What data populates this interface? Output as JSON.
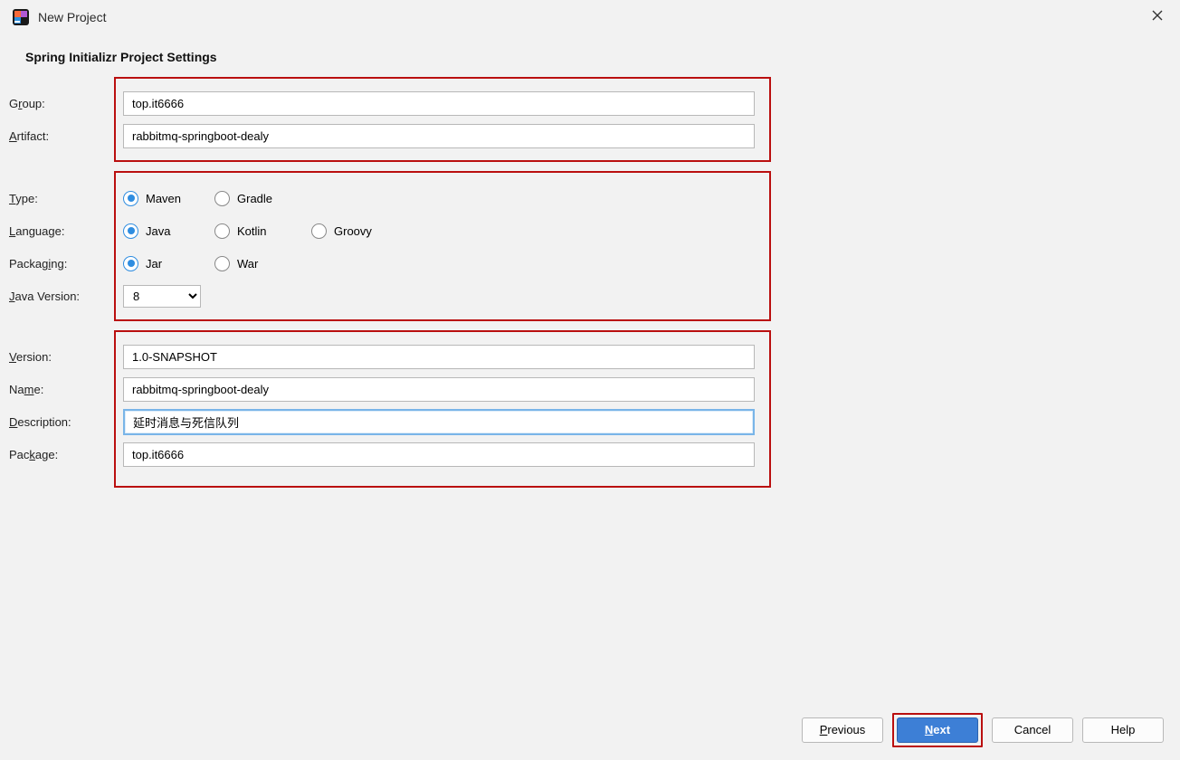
{
  "window": {
    "title": "New Project"
  },
  "heading": "Spring Initializr Project Settings",
  "labels": {
    "group_pre": "G",
    "group_u": "r",
    "group_post": "oup:",
    "artifact_u": "A",
    "artifact_post": "rtifact:",
    "type_u": "T",
    "type_post": "ype:",
    "language_u": "L",
    "language_post": "anguage:",
    "packaging_pre": "Packag",
    "packaging_u": "i",
    "packaging_post": "ng:",
    "javaver_u": "J",
    "javaver_post": "ava Version:",
    "version_u": "V",
    "version_post": "ersion:",
    "name_pre": "Na",
    "name_u": "m",
    "name_post": "e:",
    "description_u": "D",
    "description_post": "escription:",
    "package_pre": "Pac",
    "package_u": "k",
    "package_post": "age:"
  },
  "fields": {
    "group": "top.it6666",
    "artifact": "rabbitmq-springboot-dealy",
    "version": "1.0-SNAPSHOT",
    "name": "rabbitmq-springboot-dealy",
    "description": "延时消息与死信队列",
    "package": "top.it6666",
    "javaVersion": "8"
  },
  "radios": {
    "type": {
      "maven": "Maven",
      "gradle": "Gradle"
    },
    "language": {
      "java": "Java",
      "kotlin": "Kotlin",
      "groovy": "Groovy"
    },
    "packaging": {
      "jar": "Jar",
      "war": "War"
    }
  },
  "buttons": {
    "previous_u": "P",
    "previous_post": "revious",
    "next_u": "N",
    "next_post": "ext",
    "cancel": "Cancel",
    "help": "Help"
  }
}
